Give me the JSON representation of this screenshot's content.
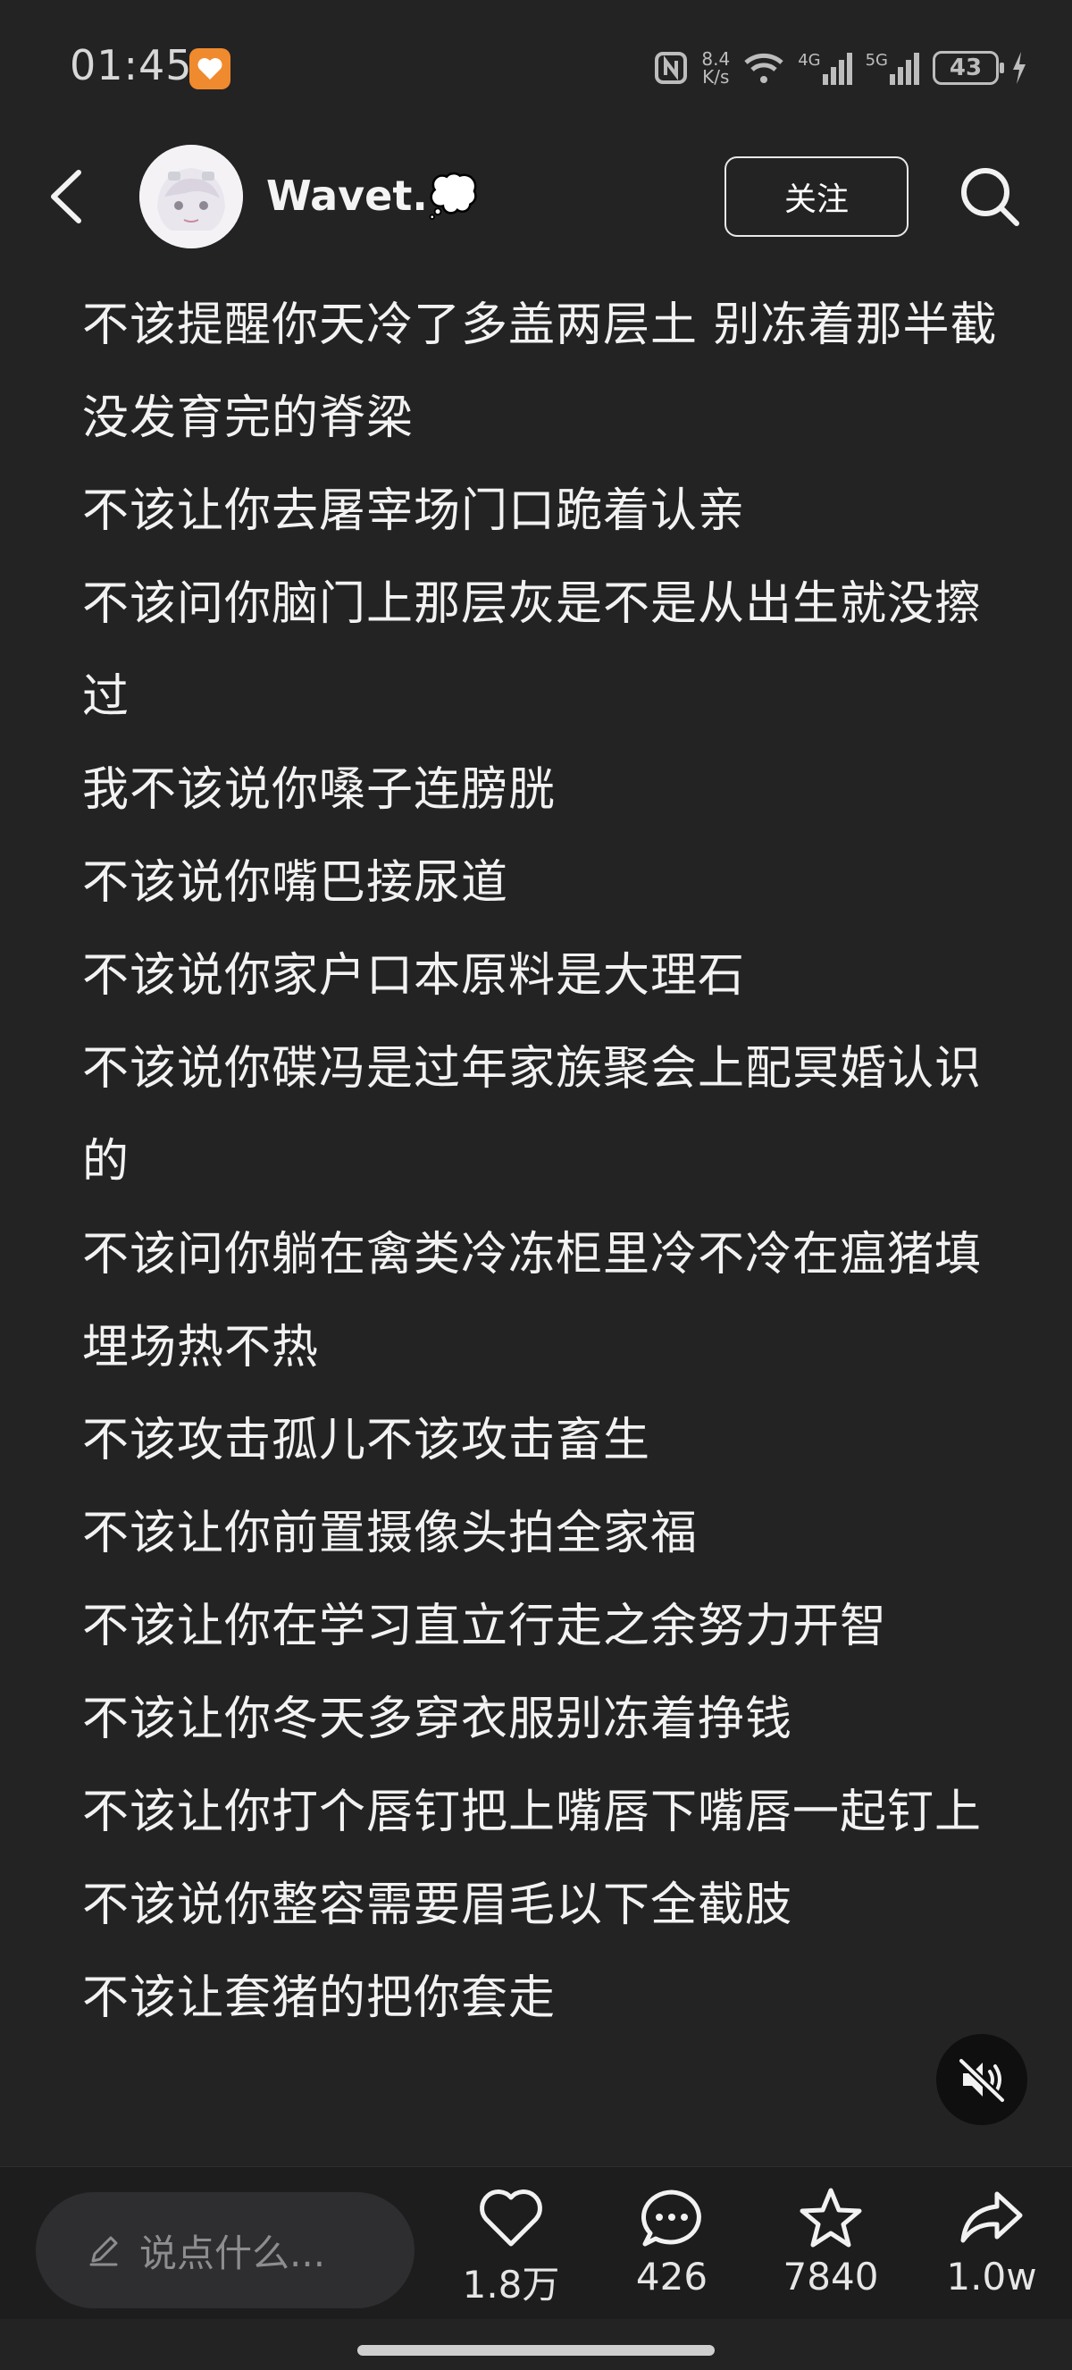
{
  "status_bar": {
    "time": "01:45",
    "net_speed": "8.4",
    "net_speed_unit": "K/s",
    "signal_4g": "4G",
    "signal_5g": "5G",
    "battery": "43"
  },
  "header": {
    "username": "Wavet.💭",
    "follow_label": "关注",
    "icons": [
      "back-arrow",
      "avatar",
      "search"
    ]
  },
  "post": {
    "lines": [
      "不该提醒你天冷了多盖两层土 别冻着那半截没发育完的脊梁",
      "不该让你去屠宰场门口跪着认亲",
      "不该问你脑门上那层灰是不是从出生就没擦过",
      "我不该说你嗓子连膀胱",
      "不该说你嘴巴接尿道",
      "不该说你家户口本原料是大理石",
      "不该说你碟冯是过年家族聚会上配冥婚认识的",
      "不该问你躺在禽类冷冻柜里冷不冷在瘟猪填埋场热不热",
      "不该攻击孤儿不该攻击畜生",
      "不该让你前置摄像头拍全家福",
      "不该让你在学习直立行走之余努力开智",
      "不该让你冬天多穿衣服别冻着挣钱",
      "不该让你打个唇钉把上嘴唇下嘴唇一起钉上",
      "不该说你整容需要眉毛以下全截肢",
      "不该让套猪的把你套走"
    ]
  },
  "bottom_bar": {
    "comment_placeholder": "说点什么...",
    "likes": "1.8万",
    "comments": "426",
    "favorites": "7840",
    "shares": "1.0w"
  },
  "colors": {
    "background": "#232324",
    "text": "#f2f2f2",
    "notification_orange": "#f08a2e"
  }
}
